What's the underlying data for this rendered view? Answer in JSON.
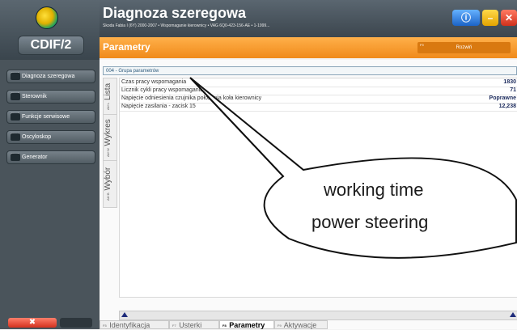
{
  "app": {
    "logo_text": "CDIF/2",
    "title": "Diagnoza szeregowa",
    "subtitle": "Skoda Fabia I (6Y) 2000-2007 • Wspomaganie kierownicy • VAG 6Q0-423-156-AE • 1-1999...",
    "section_title": "Parametry",
    "expand_button": "Rozwiń",
    "expand_key": "F9",
    "info_glyph": "ⓘ",
    "min_glyph": "–",
    "close_glyph": "✕",
    "tool_glyph": "✖"
  },
  "sidebar": {
    "items": [
      {
        "key": "Ctrl+1",
        "label": "Diagnoza szeregowa"
      },
      {
        "key": "Ctrl+2",
        "label": "Sterownik"
      },
      {
        "key": "Ctrl+3",
        "label": "Funkcje serwisowe"
      },
      {
        "key": "Ctrl+4",
        "label": "Oscyloskop"
      },
      {
        "key": "Ctrl+5",
        "label": "Generator"
      }
    ]
  },
  "main": {
    "group_header": "004 - Grupa parametrów",
    "vertical_tabs": [
      {
        "key": "Alt+L",
        "label": "Lista"
      },
      {
        "key": "Alt+W",
        "label": "Wykres"
      },
      {
        "key": "Alt+B",
        "label": "Wybór"
      }
    ],
    "params": [
      {
        "name": "Czas pracy wspomagania",
        "value": "1830"
      },
      {
        "name": "Licznik cykli pracy wspomagania",
        "value": "71"
      },
      {
        "name": "Napięcie odniesienia czujnika położenia koła kierownicy",
        "value": "Poprawne"
      },
      {
        "name": "Napięcie zasilania - zacisk 15",
        "value": "12,238"
      }
    ],
    "bottom_tabs": [
      {
        "key": "F5",
        "label": "Identyfikacja"
      },
      {
        "key": "F7",
        "label": "Usterki"
      },
      {
        "key": "F8",
        "label": "Parametry"
      },
      {
        "key": "F9",
        "label": "Aktywacje"
      }
    ]
  },
  "callout": {
    "line1": "working time",
    "line2": "power steering"
  },
  "colors": {
    "header_dark": "#3c464e",
    "accent_orange": "#f08a1a",
    "value_blue": "#1b2a5c"
  }
}
